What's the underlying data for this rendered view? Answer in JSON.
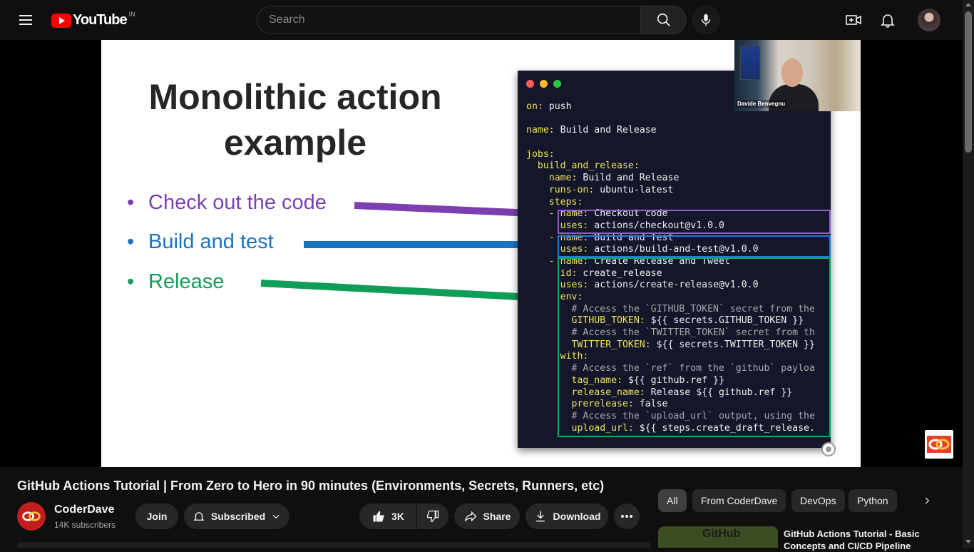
{
  "header": {
    "logo_text": "YouTube",
    "country": "IN",
    "search_placeholder": "Search"
  },
  "slide": {
    "title_line1": "Monolithic action",
    "title_line2": "example",
    "bullets": [
      {
        "text": "Check out the code",
        "color": "#7b3fb0"
      },
      {
        "text": "Build and test",
        "color": "#1a73c2"
      },
      {
        "text": "Release",
        "color": "#0f9d58"
      }
    ],
    "code_lines": [
      "on: push",
      "",
      "name: Build and Release",
      "",
      "jobs:",
      "  build_and_release:",
      "    name: Build and Release",
      "    runs-on: ubuntu-latest",
      "    steps:",
      "    - name: Checkout code",
      "      uses: actions/checkout@v1.0.0",
      "    - name: Build and Test",
      "      uses: actions/build-and-test@v1.0.0",
      "    - name: Create Release and Tweet",
      "      id: create_release",
      "      uses: actions/create-release@v1.0.0",
      "      env:",
      "        # Access the `GITHUB_TOKEN` secret from the",
      "        GITHUB_TOKEN: ${{ secrets.GITHUB_TOKEN }}",
      "        # Access the `TWITTER_TOKEN` secret from th",
      "        TWITTER_TOKEN: ${{ secrets.TWITTER_TOKEN }}",
      "      with:",
      "        # Access the `ref` from the `github` payloa",
      "        tag_name: ${{ github.ref }}",
      "        release_name: Release ${{ github.ref }}",
      "        prerelease: false",
      "        # Access the `upload_url` output, using the",
      "        upload_url: ${{ steps.create_draft_release."
    ],
    "webcam_name": "Davide Benvegnu"
  },
  "video": {
    "title": "GitHub Actions Tutorial | From Zero to Hero in 90 minutes (Environments, Secrets, Runners, etc)",
    "channel_name": "CoderDave",
    "subscribers": "14K subscribers",
    "join_label": "Join",
    "subscribed_label": "Subscribed",
    "like_count": "3K",
    "share_label": "Share",
    "download_label": "Download"
  },
  "chips": [
    "All",
    "From CoderDave",
    "DevOps",
    "Python"
  ],
  "recommendation": {
    "thumb_text": "GitHub",
    "title": "GitHub Actions Tutorial - Basic Concepts and CI/CD Pipeline"
  },
  "colors": {
    "purple": "#7b3fb0",
    "blue": "#1a73c2",
    "green": "#0f9d58"
  }
}
